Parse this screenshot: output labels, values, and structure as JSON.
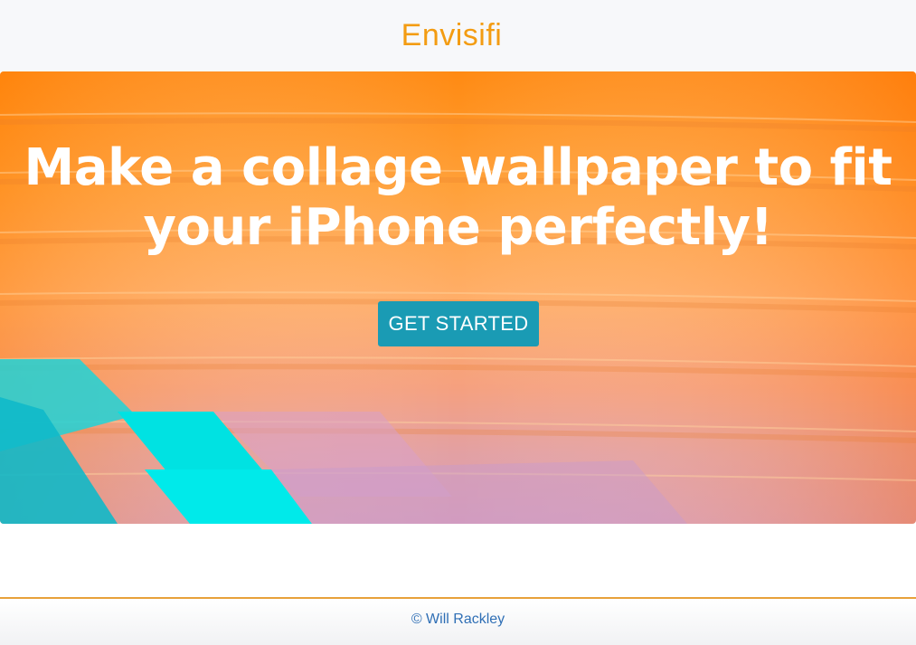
{
  "navbar": {
    "brand": "Envisifi"
  },
  "hero": {
    "title_line1": "Make a collage wallpaper to fit",
    "title_line2": "your iPhone perfectly!",
    "cta_label": "GET STARTED"
  },
  "footer": {
    "copyright": "© Will Rackley"
  },
  "colors": {
    "brand": "#f39c12",
    "cta": "#1a9bb4",
    "footer_text": "#2f6fb5",
    "footer_border": "#e8a13a"
  }
}
